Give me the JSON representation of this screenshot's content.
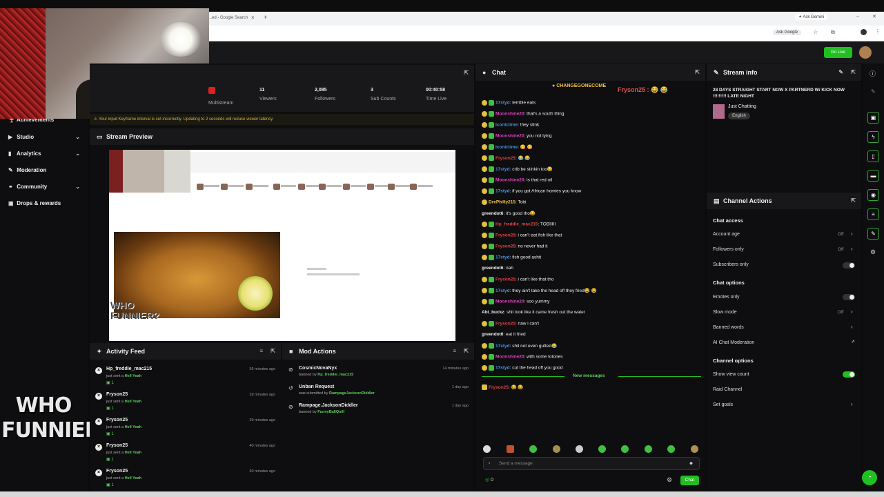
{
  "browser": {
    "tab_title": "...ed - Google Search",
    "ask_gemini": "Ask Gemini",
    "ask_google": "Ask Google"
  },
  "topnav": {
    "go_live": "Go Live"
  },
  "sidebar": {
    "items": [
      {
        "label": "Achievements",
        "icon": "trophy-icon"
      },
      {
        "label": "Studio",
        "icon": "studio-icon",
        "chevron": true
      },
      {
        "label": "Analytics",
        "icon": "chart-icon",
        "chevron": true
      },
      {
        "label": "Moderation",
        "icon": "wrench-icon"
      },
      {
        "label": "Community",
        "icon": "users-icon",
        "chevron": true
      },
      {
        "label": "Drops & rewards",
        "icon": "gift-icon"
      }
    ]
  },
  "overlay_logo": {
    "line1": "WHO",
    "line2": "FUNNIER?"
  },
  "stats": {
    "multistream": "Multistream",
    "viewers": {
      "value": "11",
      "label": "Viewers"
    },
    "followers": {
      "value": "2,085",
      "label": "Followers"
    },
    "subs": {
      "value": "3",
      "label": "Sub Counts"
    },
    "time": {
      "value": "00:40:58",
      "label": "Time Live"
    }
  },
  "warning": "Your input Keyframe interval is set incorrectly. Updating to 2 seconds will reduce viewer latency.",
  "preview": {
    "title": "Stream Preview",
    "overlay": "WHO FUNNIER?"
  },
  "activity": {
    "title": "Activity Feed",
    "items": [
      {
        "name": "Hp_freddie_mac215",
        "action": "just sent a",
        "gift": "Hell Yeah",
        "count": "1",
        "time": "36 minutes ago"
      },
      {
        "name": "Fryson25",
        "action": "just sent a",
        "gift": "Hell Yeah",
        "count": "1",
        "time": "39 minutes ago"
      },
      {
        "name": "Fryson25",
        "action": "just sent a",
        "gift": "Hell Yeah",
        "count": "1",
        "time": "39 minutes ago"
      },
      {
        "name": "Fryson25",
        "action": "just sent a",
        "gift": "Hell Yeah",
        "count": "1",
        "time": "40 minutes ago"
      },
      {
        "name": "Fryson25",
        "action": "just sent a",
        "gift": "Hell Yeah",
        "count": "1",
        "time": "40 minutes ago"
      }
    ]
  },
  "mod_actions": {
    "title": "Mod Actions",
    "items": [
      {
        "name": "CosmicNovaNyx",
        "detail": "banned by",
        "by": "Hp_freddie_mac215",
        "time": "14 minutes ago"
      },
      {
        "name": "Unban Request",
        "detail": "was submitted by",
        "by": "RampageJacksonDiddler",
        "time": "1 day ago"
      },
      {
        "name": "Rampage.JacksonDiddler",
        "detail": "banned by",
        "by": "FunnyBallQuill",
        "time": "1 day ago"
      }
    ]
  },
  "chat": {
    "title": "Chat",
    "pinned": "CHANGEGONECOME",
    "pinned_user": "Fryson25",
    "messages": [
      {
        "user": "17styd",
        "color": "#4a90e2",
        "text": ": terrible eats"
      },
      {
        "user": "Moonshine20",
        "color": "#e040c0",
        "text": ": that's a south thing"
      },
      {
        "user": "Iconictime",
        "color": "#4a90e2",
        "text": ": they stink"
      },
      {
        "user": "Moonshine20",
        "color": "#e040c0",
        "text": ": you not lying"
      },
      {
        "user": "Iconictime",
        "color": "#4a90e2",
        "text": ": 😋 😋"
      },
      {
        "user": "Fryson25",
        "color": "#e04040",
        "text": ": 😂 😂"
      },
      {
        "user": "17styd",
        "color": "#4a90e2",
        "text": ": crib be stinkin too😂"
      },
      {
        "user": "Moonshine20",
        "color": "#e040c0",
        "text": ": is that red oil"
      },
      {
        "user": "17styd",
        "color": "#4a90e2",
        "text": ": if you got African homies you know"
      },
      {
        "user": "DrePhilly215",
        "color": "#f0c040",
        "text": ": Tobi"
      },
      {
        "user": "greendot6",
        "color": "#efefef",
        "text": ": it's good tho😂"
      },
      {
        "user": "Hp_freddie_mac215",
        "color": "#e04040",
        "text": ": TOBIIIII"
      },
      {
        "user": "Fryson25",
        "color": "#e04040",
        "text": ": i can't eat fish like that"
      },
      {
        "user": "Fryson25",
        "color": "#e04040",
        "text": ": no never had it"
      },
      {
        "user": "17styd",
        "color": "#4a90e2",
        "text": ": fish good ashit"
      },
      {
        "user": "greendot6",
        "color": "#efefef",
        "text": ": nah"
      },
      {
        "user": "Fryson25",
        "color": "#e04040",
        "text": ": i can't like that tho"
      },
      {
        "user": "17styd",
        "color": "#4a90e2",
        "text": ": they ain't take the head off they fried😂 😂"
      },
      {
        "user": "Moonshine20",
        "color": "#e040c0",
        "text": ": soo yummy"
      },
      {
        "user": "Abi_buckz",
        "color": "#efefef",
        "text": ": shit look like it came fresh out the water"
      },
      {
        "user": "Fryson25",
        "color": "#e04040",
        "text": ": naw i can't"
      },
      {
        "user": "greendot6",
        "color": "#efefef",
        "text": ": eat it fried"
      },
      {
        "user": "17styd",
        "color": "#4a90e2",
        "text": ": shit not even gutted😂"
      },
      {
        "user": "Moonshine20",
        "color": "#e040c0",
        "text": ": with some totones"
      },
      {
        "user": "17styd",
        "color": "#4a90e2",
        "text": ": cut the head off you good"
      }
    ],
    "new_messages": "New messages",
    "new_message": {
      "user": "Fryson25",
      "color": "#e04040",
      "text": ": 😂 😂"
    },
    "input_placeholder": "Send a message",
    "points": "0",
    "send_label": "Chat"
  },
  "stream_info": {
    "title_label": "Stream info",
    "stream_title": "28 DAYS STRAIGHT START NOW X PARTNERD W/ KICK NOW !!!!!!!!! LATE NIGHT",
    "category": "Just Chatting",
    "language": "English"
  },
  "channel_actions": {
    "title": "Channel Actions",
    "chat_access": "Chat access",
    "account_age": {
      "label": "Account age",
      "value": "Off"
    },
    "followers_only": {
      "label": "Followers only",
      "value": "Off"
    },
    "subscribers_only": "Subscribers only",
    "chat_options": "Chat options",
    "emotes_only": "Emotes only",
    "slow_mode": {
      "label": "Slow mode",
      "value": "Off"
    },
    "banned_words": "Banned words",
    "ai_moderation": "AI Chat Moderation",
    "channel_options": "Channel options",
    "show_view_count": "Show view count",
    "raid_channel": "Raid Channel",
    "set_goals": "Set goals"
  },
  "colors": {
    "accent": "#20c020",
    "bg": "#0e0e10",
    "panel": "#18181b"
  }
}
